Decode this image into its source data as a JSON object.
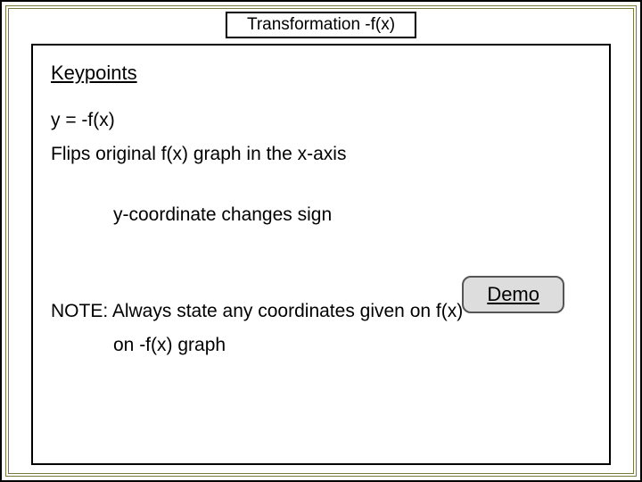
{
  "title": "Transformation -f(x)",
  "heading": "Keypoints",
  "equation": "y = -f(x)",
  "desc": "Flips original f(x) graph in the x-axis",
  "coord_note": "y-coordinate changes sign",
  "demo_label": "Demo",
  "note_line1": "NOTE: Always state any coordinates given on f(x)",
  "note_line2": "on -f(x) graph"
}
